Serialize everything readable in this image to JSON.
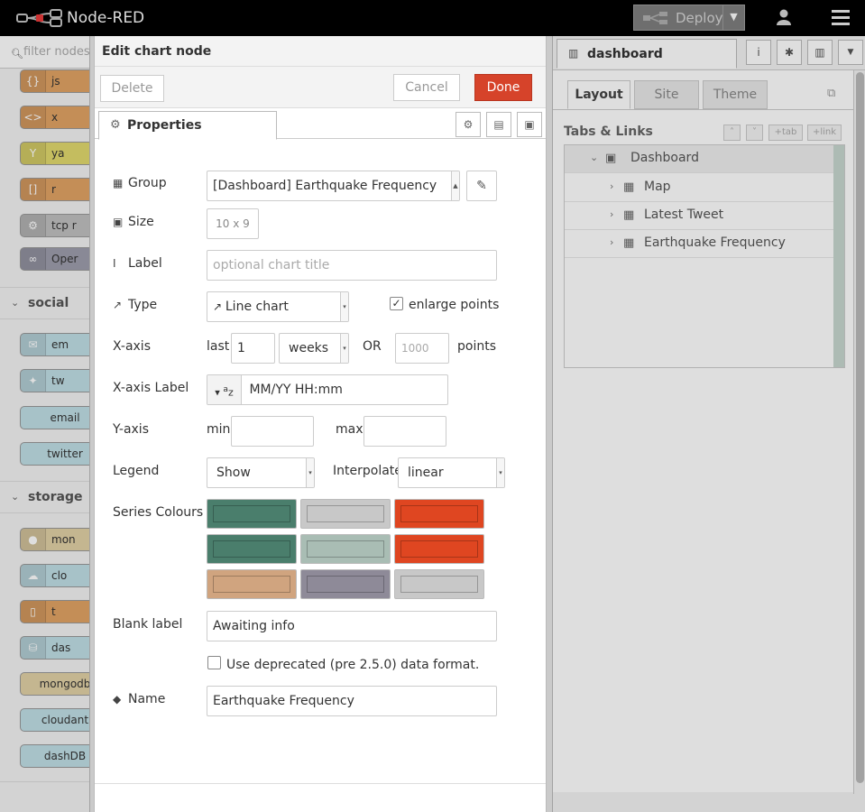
{
  "app": {
    "title": "Node-RED",
    "deploy_label": "Deploy"
  },
  "palette": {
    "search_placeholder": "filter nodes",
    "nodes_top": [
      {
        "label": "js",
        "color": "#e2a465"
      },
      {
        "label": "x",
        "color": "#e2a465"
      },
      {
        "label": "ya",
        "color": "#e2d96e"
      },
      {
        "label": "r",
        "color": "#e2a465"
      },
      {
        "label": "tcp r",
        "color": "#c0c0c0"
      },
      {
        "label": "Oper",
        "color": "#9e9ead"
      }
    ],
    "social": {
      "label": "social",
      "nodes": [
        {
          "label": "em",
          "color": "#c0dfe6"
        },
        {
          "label": "tw",
          "color": "#c0dfe6"
        },
        {
          "label": "email",
          "color": "#c0dfe6"
        },
        {
          "label": "twitter",
          "color": "#c0dfe6"
        }
      ]
    },
    "storage": {
      "label": "storage",
      "nodes": [
        {
          "label": "mon",
          "color": "#e2d1a6"
        },
        {
          "label": "clo",
          "color": "#c0dfe6"
        },
        {
          "label": "t",
          "color": "#e2a465"
        },
        {
          "label": "das",
          "color": "#c0dfe6"
        },
        {
          "label": "mongodb",
          "color": "#e2d1a6"
        },
        {
          "label": "cloudant",
          "color": "#c0dfe6"
        },
        {
          "label": "dashDB",
          "color": "#c0dfe6"
        }
      ]
    }
  },
  "editor": {
    "title": "Edit chart node",
    "delete_label": "Delete",
    "cancel_label": "Cancel",
    "done_label": "Done",
    "tab_label": "Properties",
    "group": {
      "label": "Group",
      "value": "[Dashboard] Earthquake Frequency"
    },
    "size": {
      "label": "Size",
      "value": "10 x 9"
    },
    "title_field": {
      "label": "Label",
      "placeholder": "optional chart title"
    },
    "type": {
      "label": "Type",
      "value": "Line chart",
      "enlarge_label": "enlarge points",
      "enlarge_checked": true
    },
    "xaxis": {
      "label": "X-axis",
      "last_label": "last",
      "last_value": "1",
      "unit_value": "weeks",
      "or_label": "OR",
      "points_placeholder": "1000",
      "points_label": "points"
    },
    "xaxis_label": {
      "label": "X-axis Label",
      "value": "MM/YY HH:mm"
    },
    "yaxis": {
      "label": "Y-axis",
      "min_label": "min",
      "max_label": "max"
    },
    "legend": {
      "label": "Legend",
      "value": "Show",
      "interpolate_label": "Interpolate",
      "interpolate_value": "linear"
    },
    "series": {
      "label": "Series Colours",
      "colors": [
        "#4a7e6c",
        "#c8c8c8",
        "#df4621",
        "#4a7e6c",
        "#a9bdb4",
        "#df4621",
        "#d0a47f",
        "#8e8a98",
        "#c8c8c8"
      ]
    },
    "blank": {
      "label": "Blank label",
      "value": "Awaiting info"
    },
    "deprecated_label": "Use deprecated (pre 2.5.0) data format.",
    "name": {
      "label": "Name",
      "value": "Earthquake Frequency"
    }
  },
  "sidebar": {
    "tab_label": "dashboard",
    "subtabs": [
      "Layout",
      "Site",
      "Theme"
    ],
    "tabs_links_title": "Tabs & Links",
    "btn_tab": "tab",
    "btn_link": "link",
    "tree": {
      "root": "Dashboard",
      "items": [
        "Map",
        "Latest Tweet",
        "Earthquake Frequency"
      ]
    }
  }
}
